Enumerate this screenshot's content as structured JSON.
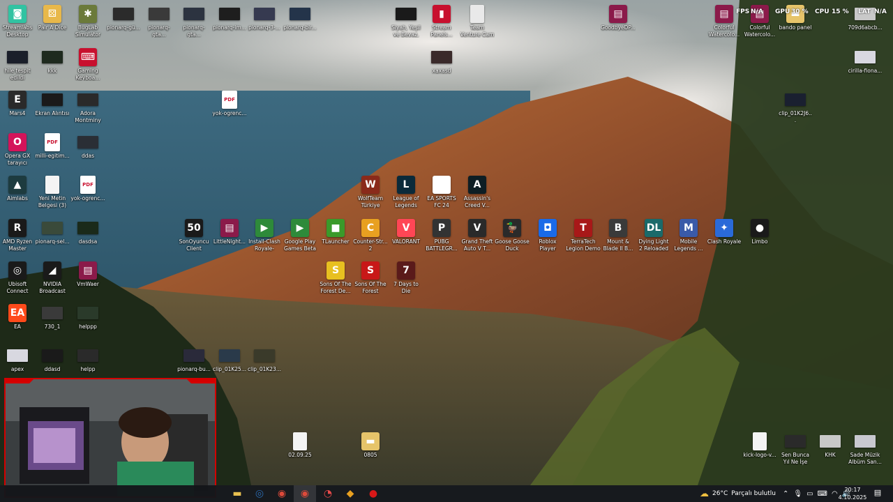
{
  "overlay": {
    "fps_label": "FPS",
    "fps_value": "N/A",
    "gpu_label": "GPU",
    "gpu_value": "30 %",
    "cpu_label": "CPU",
    "cpu_value": "15 %",
    "lat_label": "LAT",
    "lat_value": "N/A"
  },
  "icons": [
    {
      "label": "Streamlabs Desktop",
      "icon": "streamlabs-icon",
      "color": "#31c3a2",
      "glyph": "◙"
    },
    {
      "label": "Pair A Dice",
      "icon": "dice-icon",
      "color": "#e8b84a",
      "glyph": "⚄"
    },
    {
      "label": "BugLab Simulator",
      "icon": "buglab-icon",
      "color": "#6b7a3a",
      "glyph": "✱"
    },
    {
      "label": "pionarq-gü...",
      "icon": "video-thumb-icon",
      "color": "#2b2b2b",
      "glyph": ""
    },
    {
      "label": "pionarq-gta...",
      "icon": "video-thumb-icon",
      "color": "#3a3a3a",
      "glyph": ""
    },
    {
      "label": "pionarq-gta...",
      "icon": "video-thumb-icon",
      "color": "#2c3340",
      "glyph": ""
    },
    {
      "label": "pionarq-im...",
      "icon": "video-thumb-icon",
      "color": "#1e1e1e",
      "glyph": ""
    },
    {
      "label": "pionarq-3-...",
      "icon": "video-thumb-icon",
      "color": "#363a50",
      "glyph": ""
    },
    {
      "label": "pionarq-bir...",
      "icon": "video-thumb-icon",
      "color": "#24344a",
      "glyph": ""
    },
    {
      "label": "Siyah, Yeşil ve Beyaz, Hiye...",
      "icon": "image-thumb-icon",
      "color": "#1a1a1a",
      "glyph": ""
    },
    {
      "label": "Stream Panels...",
      "icon": "stream-panel-icon",
      "color": "#c8102e",
      "glyph": "▮"
    },
    {
      "label": "Team Venture Cam",
      "icon": "doc-icon",
      "color": "#e9e9e9",
      "glyph": ""
    },
    {
      "label": "GoodbyeDP...",
      "icon": "winrar-icon",
      "color": "#8b1a4a",
      "glyph": "▤"
    },
    {
      "label": "Colorful Watercolo...",
      "icon": "winrar-icon",
      "color": "#8b1a4a",
      "glyph": "▤"
    },
    {
      "label": "Colorful Watercolo...",
      "icon": "winrar-icon",
      "color": "#8b1a4a",
      "glyph": "▤"
    },
    {
      "label": "bando panel",
      "icon": "folder-icon",
      "color": "#e6c46a",
      "glyph": "▬"
    },
    {
      "label": "709d6abcb...",
      "icon": "avatar-icon",
      "color": "#c9c9c9",
      "glyph": ""
    },
    {
      "label": "hile tespit edildi",
      "icon": "video-thumb-icon",
      "color": "#1a1f2a",
      "glyph": ""
    },
    {
      "label": "kkk",
      "icon": "video-thumb-icon",
      "color": "#1e2a1e",
      "glyph": ""
    },
    {
      "label": "Gaming Keyboa...",
      "icon": "keyboard-icon",
      "color": "#c8102e",
      "glyph": "⌨"
    },
    {
      "label": "xaxasd",
      "icon": "image-thumb-icon",
      "color": "#3a2a2a",
      "glyph": ""
    },
    {
      "label": "cirilla-fiona...",
      "icon": "image-thumb-icon",
      "color": "#d8d8e0",
      "glyph": ""
    },
    {
      "label": "Mars4",
      "icon": "epic-games-icon",
      "color": "#2a2a2a",
      "glyph": "E"
    },
    {
      "label": "Ekran Alıntısı",
      "icon": "image-thumb-icon",
      "color": "#1a1a1a",
      "glyph": ""
    },
    {
      "label": "Adora Montminy",
      "icon": "image-thumb-icon",
      "color": "#2a2a2a",
      "glyph": ""
    },
    {
      "label": "yok-ogrenc...",
      "icon": "pdf-icon",
      "color": "#ffffff",
      "glyph": "PDF"
    },
    {
      "label": "clip_01K2J6...",
      "icon": "video-thumb-icon",
      "color": "#1a2030",
      "glyph": ""
    },
    {
      "label": "Opera GX tarayıcı",
      "icon": "opera-gx-icon",
      "color": "#d4145a",
      "glyph": "O"
    },
    {
      "label": "milli-egitim...",
      "icon": "pdf-icon",
      "color": "#ffffff",
      "glyph": "PDF"
    },
    {
      "label": "ddas",
      "icon": "video-thumb-icon",
      "color": "#2a2e35",
      "glyph": ""
    },
    {
      "label": "Aimlabs",
      "icon": "aimlabs-icon",
      "color": "#1d3b3f",
      "glyph": "▲"
    },
    {
      "label": "Yeni Metin Belgesi (3)",
      "icon": "doc-icon",
      "color": "#f4f4f4",
      "glyph": ""
    },
    {
      "label": "yok-ogrenc...",
      "icon": "pdf-icon",
      "color": "#ffffff",
      "glyph": "PDF"
    },
    {
      "label": "WolfTeam Türkiye",
      "icon": "wolfteam-icon",
      "color": "#8a2a1a",
      "glyph": "W"
    },
    {
      "label": "League of Legends",
      "icon": "league-icon",
      "color": "#0a2a3a",
      "glyph": "L"
    },
    {
      "label": "EA SPORTS FC 24",
      "icon": "ea-fc-icon",
      "color": "#ffffff",
      "glyph": "FC"
    },
    {
      "label": "Assassin's Creed V...",
      "icon": "assassins-creed-icon",
      "color": "#0e1e24",
      "glyph": "A"
    },
    {
      "label": "AMD Ryzen Master",
      "icon": "amd-icon",
      "color": "#1a1a1a",
      "glyph": "R"
    },
    {
      "label": "pionarq-sel...",
      "icon": "video-thumb-icon",
      "color": "#3a4a3a",
      "glyph": ""
    },
    {
      "label": "dasdsa",
      "icon": "video-thumb-icon",
      "color": "#1a2a1a",
      "glyph": ""
    },
    {
      "label": "SonOyuncu Client",
      "icon": "sonoyuncu-icon",
      "color": "#1a1a1a",
      "glyph": "50"
    },
    {
      "label": "LittleNight...",
      "icon": "winrar-icon",
      "color": "#8b1a4a",
      "glyph": "▤"
    },
    {
      "label": "Install-Clash Royale-Goo...",
      "icon": "google-play-icon",
      "color": "#2e8a3a",
      "glyph": "▶"
    },
    {
      "label": "Google Play Games Beta",
      "icon": "google-play-icon",
      "color": "#2e8a3a",
      "glyph": "▶"
    },
    {
      "label": "TLauncher",
      "icon": "tlauncher-icon",
      "color": "#3a9a2a",
      "glyph": "■"
    },
    {
      "label": "Counter-Str... 2",
      "icon": "cs2-icon",
      "color": "#e8a020",
      "glyph": "C"
    },
    {
      "label": "VALORANT",
      "icon": "valorant-icon",
      "color": "#ff4655",
      "glyph": "V"
    },
    {
      "label": "PUBG BATTLEGR...",
      "icon": "pubg-icon",
      "color": "#333333",
      "glyph": "P"
    },
    {
      "label": "Grand Theft Auto V T...",
      "icon": "gta-icon",
      "color": "#2a2a2a",
      "glyph": "V"
    },
    {
      "label": "Goose Goose Duck",
      "icon": "goose-icon",
      "color": "#2a2a2a",
      "glyph": "🦆"
    },
    {
      "label": "Roblox Player",
      "icon": "roblox-icon",
      "color": "#1a6ae8",
      "glyph": "◘"
    },
    {
      "label": "TerraTech Legion Demo",
      "icon": "terratech-icon",
      "color": "#a81818",
      "glyph": "T"
    },
    {
      "label": "Mount & Blade II B...",
      "icon": "mount-blade-icon",
      "color": "#3a3a3a",
      "glyph": "B"
    },
    {
      "label": "Dying Light 2 Reloaded E...",
      "icon": "dying-light-icon",
      "color": "#1a6a6a",
      "glyph": "DL"
    },
    {
      "label": "Mobile Legends ...",
      "icon": "mobile-legends-icon",
      "color": "#3a5aa8",
      "glyph": "M"
    },
    {
      "label": "Clash Royale",
      "icon": "clash-royale-icon",
      "color": "#2a6ad8",
      "glyph": "✦"
    },
    {
      "label": "Limbo",
      "icon": "limbo-icon",
      "color": "#1a1a1a",
      "glyph": "●"
    },
    {
      "label": "Ubisoft Connect",
      "icon": "ubisoft-icon",
      "color": "#1a1a1a",
      "glyph": "◎"
    },
    {
      "label": "NVIDIA Broadcast",
      "icon": "nvidia-icon",
      "color": "#1a1a1a",
      "glyph": "◢"
    },
    {
      "label": "VmWaer",
      "icon": "winrar-icon",
      "color": "#8b1a4a",
      "glyph": "▤"
    },
    {
      "label": "Sons Of The Forest De...",
      "icon": "sons-forest-icon",
      "color": "#e8c020",
      "glyph": "S"
    },
    {
      "label": "Sons Of The Forest",
      "icon": "sons-forest-icon",
      "color": "#c81818",
      "glyph": "S"
    },
    {
      "label": "7 Days to Die",
      "icon": "7-days-icon",
      "color": "#5a1a1a",
      "glyph": "7"
    },
    {
      "label": "EA",
      "icon": "ea-icon",
      "color": "#ff4a1a",
      "glyph": "EA"
    },
    {
      "label": "730_1",
      "icon": "video-thumb-icon",
      "color": "#3a3a3a",
      "glyph": ""
    },
    {
      "label": "helppp",
      "icon": "video-thumb-icon",
      "color": "#2a3a2a",
      "glyph": ""
    },
    {
      "label": "apex",
      "icon": "image-thumb-icon",
      "color": "#d8d8e0",
      "glyph": ""
    },
    {
      "label": "ddasd",
      "icon": "video-thumb-icon",
      "color": "#1a1a1a",
      "glyph": ""
    },
    {
      "label": "helpp",
      "icon": "video-thumb-icon",
      "color": "#2a2a2a",
      "glyph": ""
    },
    {
      "label": "pionarq-bu...",
      "icon": "video-thumb-icon",
      "color": "#2a2a3a",
      "glyph": ""
    },
    {
      "label": "clip_01K25...",
      "icon": "video-thumb-icon",
      "color": "#2a3a4a",
      "glyph": ""
    },
    {
      "label": "clip_01K23...",
      "icon": "video-thumb-icon",
      "color": "#3a3a2a",
      "glyph": ""
    },
    {
      "label": "02.09.25",
      "icon": "doc-icon",
      "color": "#f4f4f4",
      "glyph": ""
    },
    {
      "label": "0805",
      "icon": "zip-folder-icon",
      "color": "#e6c46a",
      "glyph": "▬"
    },
    {
      "label": "kick-logo-v...",
      "icon": "doc-icon",
      "color": "#f4f4f4",
      "glyph": ""
    },
    {
      "label": "Sen Bunca Yıl Ne İşe Yara...",
      "icon": "image-thumb-icon",
      "color": "#2a2a2a",
      "glyph": ""
    },
    {
      "label": "KHK",
      "icon": "image-thumb-icon",
      "color": "#c8c8c8",
      "glyph": ""
    },
    {
      "label": "Sade Müzik Albüm San...",
      "icon": "image-thumb-icon",
      "color": "#c8c8d0",
      "glyph": ""
    }
  ],
  "taskbar": {
    "apps": [
      {
        "icon": "file-explorer-icon",
        "color": "#e8c050",
        "glyph": "▬"
      },
      {
        "icon": "steam-icon",
        "color": "#2a6ab0",
        "glyph": "◎"
      },
      {
        "icon": "chrome-icon",
        "color": "#dd4a3a",
        "glyph": "◉"
      },
      {
        "icon": "chrome-profile-icon",
        "color": "#dd4a3a",
        "glyph": "◉"
      },
      {
        "icon": "obs-icon",
        "color": "#e84a4a",
        "glyph": "◔"
      },
      {
        "icon": "tool-icon",
        "color": "#e8a020",
        "glyph": "◆"
      },
      {
        "icon": "recording-icon",
        "color": "#d81818",
        "glyph": "●"
      }
    ],
    "weather_temp": "26°C",
    "weather_text": "Parçalı bulutlu",
    "time": "20:17",
    "date": "4.10.2025"
  }
}
